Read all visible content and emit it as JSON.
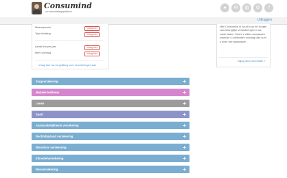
{
  "header": {
    "brand": "Consumind",
    "tagline": "uw bemiddelingsplatform",
    "icons": [
      "user-icon",
      "message-icon",
      "document-icon",
      "settings-icon",
      "help-icon"
    ],
    "login_label": "Uitloggen"
  },
  "left_panel": {
    "fields": [
      {
        "label": "Maandpremie",
        "badge": "Vraag hier"
      },
      {
        "label": "Type betaling",
        "badge": "Vraag hier"
      },
      {
        "label": "Aantal km per jaar",
        "badge": "Vraag hier"
      },
      {
        "label": "Merk voertuig",
        "badge": "Vraag hier"
      }
    ],
    "compare_link": "Vraag hier uw vergelijking voor verzekeringen aan"
  },
  "right_panel": {
    "text": "Mijn Consumind in houdt u op de hoogte van belangrijke veranderingen in uw vaste lasten. Mocht u willen aanpassen waarvan u notificaties ontvangt dan kunt u deze hier aanpassen.",
    "link": "Wijzig deze informatie »"
  },
  "accordion": [
    {
      "label": "Zorgverzekering",
      "color": "#7aadd0"
    },
    {
      "label": "Mobiele telefonie",
      "color": "#d585ce"
    },
    {
      "label": "Lenen",
      "color": "#9b9b9b"
    },
    {
      "label": "Sport",
      "color": "#8d93c9"
    },
    {
      "label": "Aansprakelijkheids verzekering",
      "color": "#7aadd0"
    },
    {
      "label": "Rechtsbijstand verzekering",
      "color": "#7aadd0"
    },
    {
      "label": "Woonhuis verzekering",
      "color": "#7aadd0"
    },
    {
      "label": "Inboedelverzekering",
      "color": "#7aadd0"
    },
    {
      "label": "Reisverzekering",
      "color": "#7aadd0"
    }
  ]
}
